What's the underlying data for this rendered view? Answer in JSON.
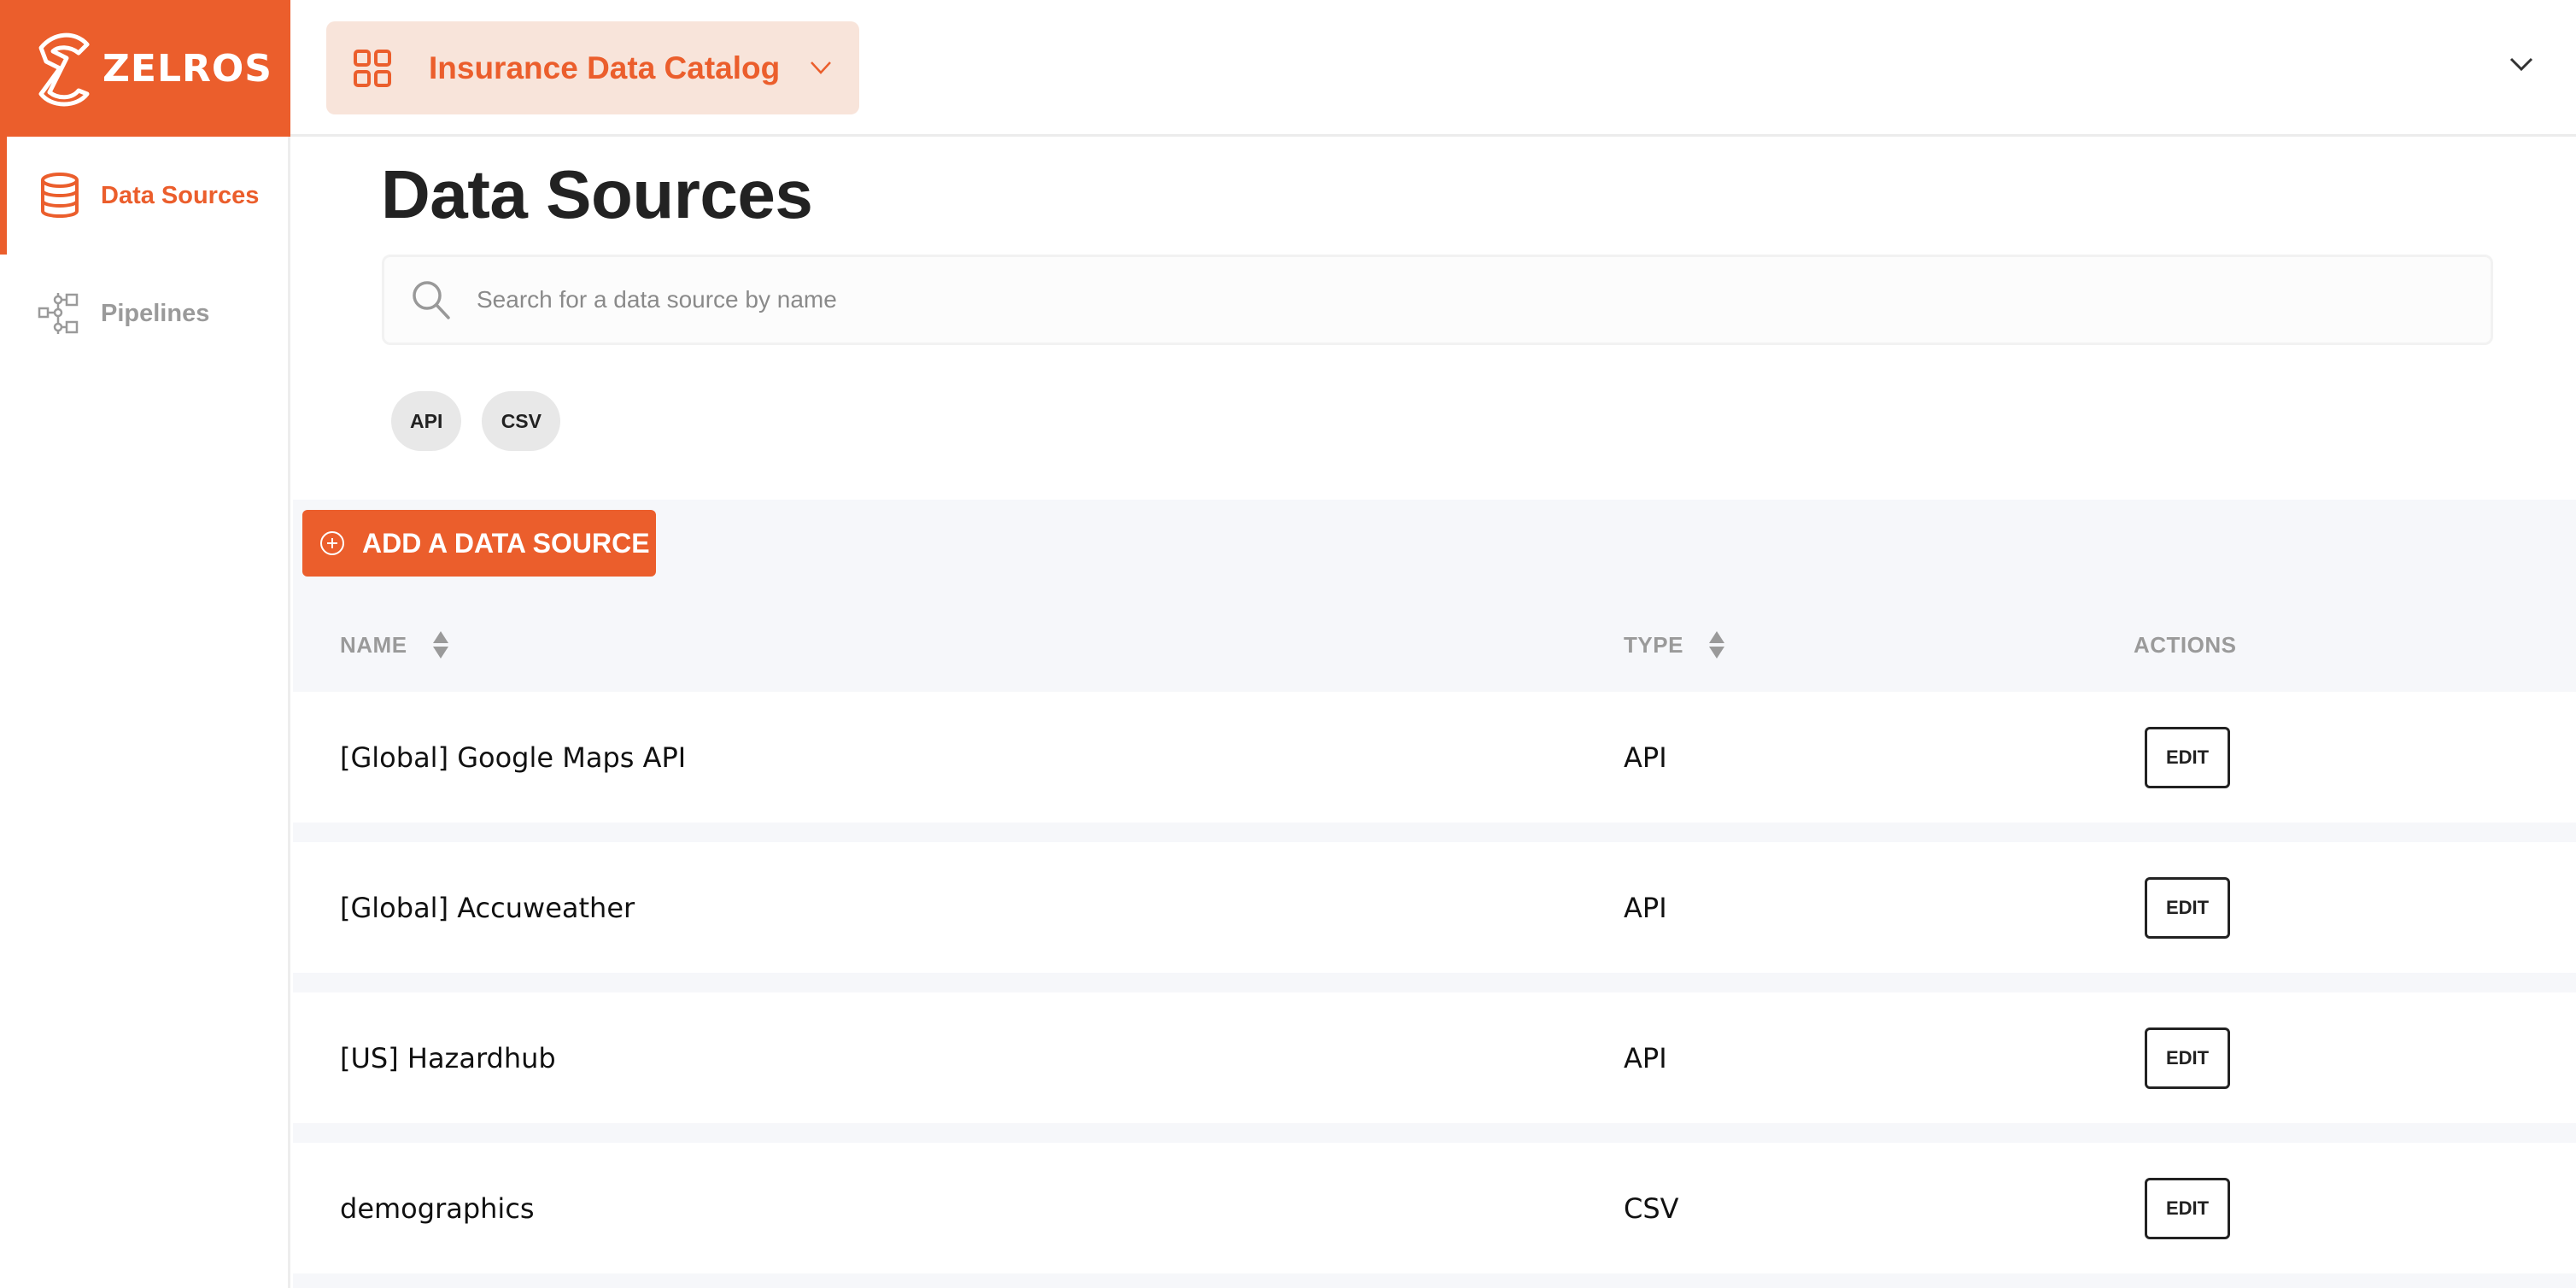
{
  "brand": {
    "name": "ZELROS",
    "color": "#EB5E2C"
  },
  "sidebar": {
    "items": [
      {
        "label": "Data Sources",
        "icon": "database-icon",
        "active": true
      },
      {
        "label": "Pipelines",
        "icon": "pipeline-icon",
        "active": false
      }
    ]
  },
  "header": {
    "catalog": {
      "label": "Insurance Data Catalog",
      "icon": "grid-icon"
    },
    "menu_icon": "chevron-down-icon"
  },
  "main": {
    "title": "Data Sources",
    "search": {
      "placeholder": "Search for a data source by name",
      "value": ""
    },
    "filters": [
      "API",
      "CSV"
    ],
    "add_button": "ADD A DATA SOURCE",
    "table": {
      "columns": [
        {
          "label": "NAME",
          "sortable": true
        },
        {
          "label": "TYPE",
          "sortable": true
        },
        {
          "label": "ACTIONS",
          "sortable": false
        }
      ],
      "rows": [
        {
          "name": "[Global] Google Maps API",
          "type": "API",
          "action": "EDIT"
        },
        {
          "name": "[Global] Accuweather",
          "type": "API",
          "action": "EDIT"
        },
        {
          "name": "[US] Hazardhub",
          "type": "API",
          "action": "EDIT"
        },
        {
          "name": "demographics",
          "type": "CSV",
          "action": "EDIT"
        }
      ]
    }
  }
}
